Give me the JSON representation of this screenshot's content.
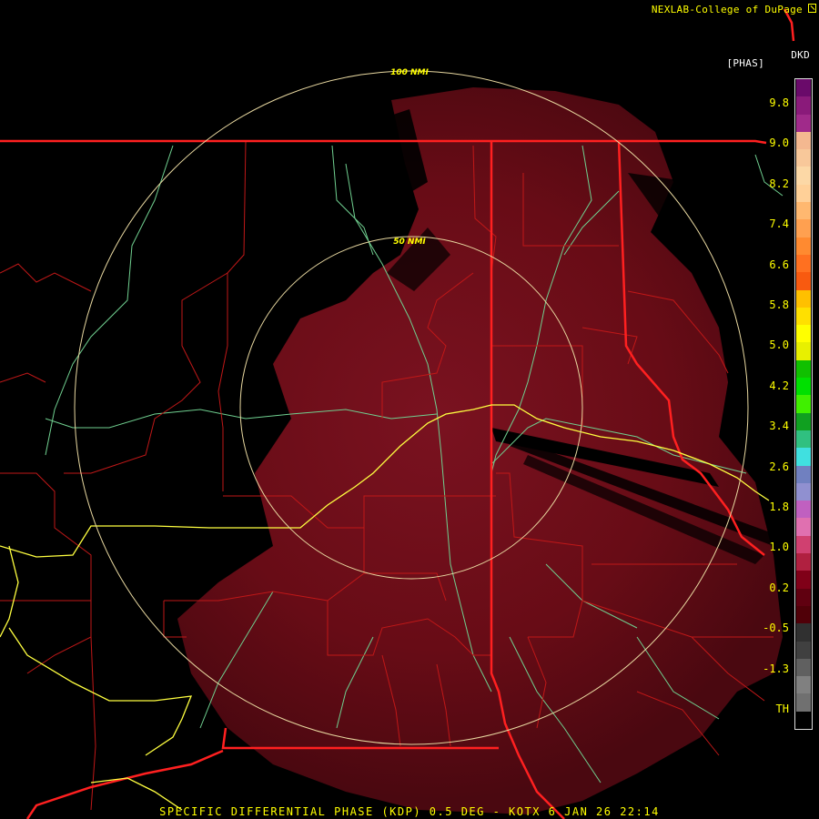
{
  "header": {
    "credit": "NEXLAB-College of DuPage",
    "site": "DKD",
    "unit": "[PHAS]"
  },
  "footer": {
    "caption": "SPECIFIC DIFFERENTIAL PHASE (KDP) 0.5 DEG - KOTX 6 JAN 26 22:14"
  },
  "range_rings": {
    "inner_label": "50 NMI",
    "outer_label": "100 NMI"
  },
  "legend": {
    "ticks": [
      "9.8",
      "9.0",
      "8.2",
      "7.4",
      "6.6",
      "5.8",
      "5.0",
      "4.2",
      "3.4",
      "2.6",
      "1.8",
      "1.0",
      "0.2",
      "-0.5",
      "-1.3",
      "TH"
    ],
    "colors": [
      "#6a0a6a",
      "#8a1a7a",
      "#a02a8a",
      "#f4b890",
      "#f8c89a",
      "#fcd8a6",
      "#ffd098",
      "#ffb870",
      "#ffa050",
      "#ff8a30",
      "#ff7020",
      "#f85a10",
      "#ffc000",
      "#ffe000",
      "#ffff00",
      "#e8f000",
      "#10c000",
      "#00e000",
      "#40f000",
      "#10a020",
      "#30c080",
      "#40e0e0",
      "#7080c0",
      "#9090d0",
      "#c060c0",
      "#e070b0",
      "#d04070",
      "#b02040",
      "#800018",
      "#600010",
      "#500008",
      "#303030",
      "#404040",
      "#606060",
      "#808080",
      "#707070",
      "#000000"
    ]
  },
  "colors": {
    "state_border": "#ff2020",
    "county_line": "#c01818",
    "highway": "#ffff40",
    "river": "#70d090",
    "ring": "#e8d8a0",
    "echo": "#6a0c14"
  }
}
